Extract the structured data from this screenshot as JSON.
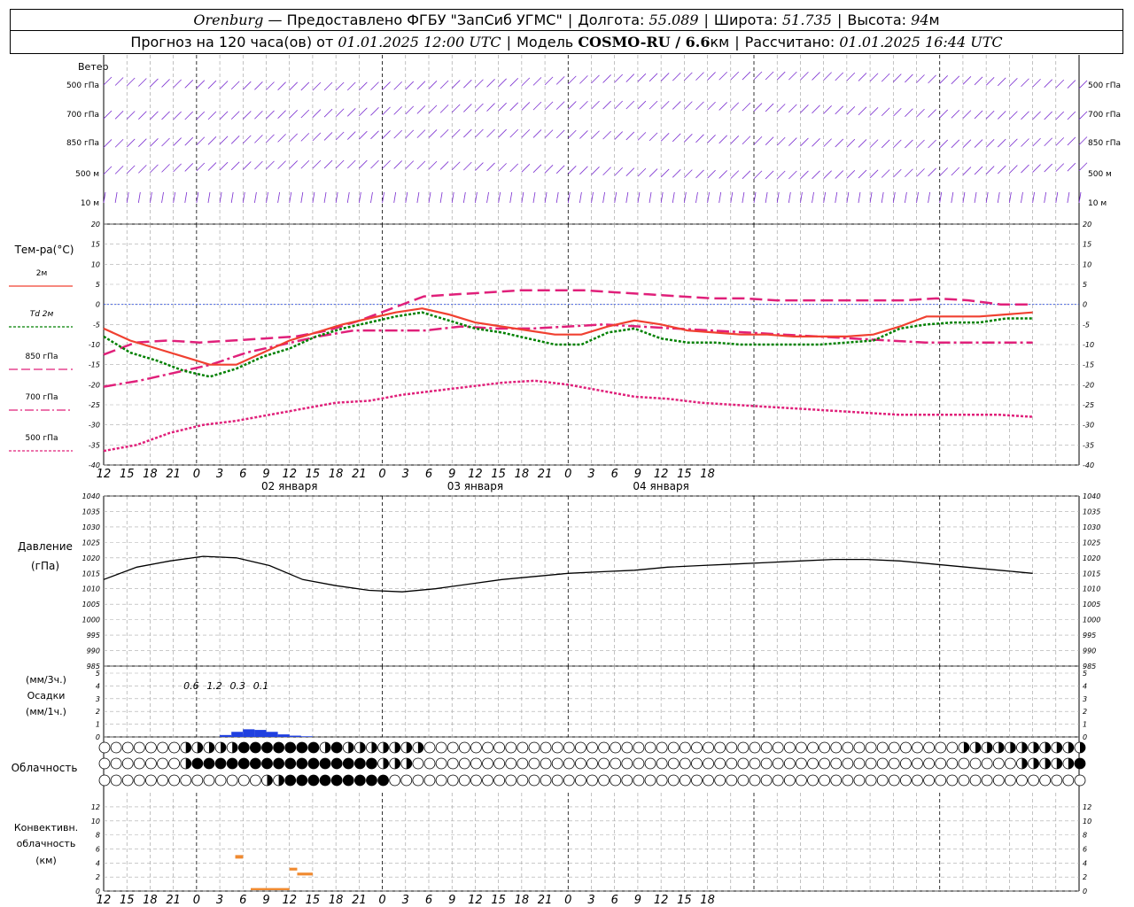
{
  "header": {
    "city": "Orenburg",
    "provider": "— Предоставлено ФГБУ \"ЗапСиб УГМС\"",
    "lon_label": "Долгота:",
    "lon": "55.089",
    "lat_label": "Широта:",
    "lat": "51.735",
    "alt_label": "Высота:",
    "alt": "94",
    "alt_unit": "м",
    "fc_label": "Прогноз на 120 часа(ов) от",
    "fc_time": "01.01.2025 12:00 UTC",
    "model_label": "Модель",
    "model": "COSMO-RU / 6.6",
    "model_unit": "км",
    "calc_label": "Рассчитано:",
    "calc_time": "01.01.2025 16:44 UTC"
  },
  "x_ticks": [
    "12",
    "15",
    "18",
    "21",
    "0",
    "3",
    "6",
    "9",
    "12",
    "15",
    "18",
    "21",
    "0",
    "3",
    "6",
    "9",
    "12",
    "15",
    "18",
    "21",
    "0",
    "3",
    "6",
    "9",
    "12",
    "15",
    "18"
  ],
  "dates": [
    "02 января",
    "03 января",
    "04 января"
  ],
  "wind_panel": {
    "title": "Ветер",
    "levels": [
      "500 гПа",
      "700 гПа",
      "850 гПа",
      "500 м",
      "10 м"
    ]
  },
  "temp_panel": {
    "title": "Тем-ра(°С)",
    "legend": [
      {
        "label": "2м",
        "color": "#f04030",
        "style": "solid"
      },
      {
        "label": "Td  2м",
        "color": "#008000",
        "style": "dotted"
      },
      {
        "label": "850 гПа",
        "color": "#e0207a",
        "style": "dash"
      },
      {
        "label": "700 гПа",
        "color": "#e0207a",
        "style": "dashdot"
      },
      {
        "label": "500 гПа",
        "color": "#e0207a",
        "style": "dotted"
      }
    ],
    "y_ticks": [
      "20",
      "15",
      "10",
      "5",
      "0",
      "-5",
      "-10",
      "-15",
      "-20",
      "-25",
      "-30",
      "-35",
      "-40"
    ]
  },
  "pressure_panel": {
    "title": "Давление",
    "unit": "(гПа)",
    "y_ticks": [
      "1040",
      "1035",
      "1030",
      "1025",
      "1020",
      "1015",
      "1010",
      "1005",
      "1000",
      "995",
      "990",
      "985"
    ]
  },
  "precip_panel": {
    "title": "Осадки",
    "unit_top": "(мм/3ч.)",
    "unit_bottom": "(мм/1ч.)",
    "y_ticks": [
      "5",
      "4",
      "3",
      "2",
      "1",
      "0"
    ],
    "totals": [
      {
        "hour": 6,
        "label": "0.6"
      },
      {
        "hour": 9,
        "label": "1.2"
      },
      {
        "hour": 12,
        "label": "0.3"
      },
      {
        "hour": 15,
        "label": "0.1"
      }
    ]
  },
  "cloud_panel": {
    "title": "Облачность"
  },
  "conv_panel": {
    "title_1": "Конвективн.",
    "title_2": "облачность",
    "unit": "(км)",
    "y_ticks": [
      "12",
      "10",
      "8",
      "6",
      "4",
      "2",
      "0"
    ]
  },
  "chart_data": {
    "type": "line",
    "x_hours": [
      0,
      6,
      9,
      12,
      15,
      18,
      21,
      24,
      27,
      30,
      33,
      36,
      39,
      42,
      45,
      48,
      51,
      54,
      57,
      60,
      63,
      66,
      69,
      72,
      75,
      78,
      81,
      84,
      87,
      90,
      93,
      96,
      99,
      102,
      105,
      108,
      111,
      114,
      117,
      120
    ],
    "series": [
      {
        "name": "2м",
        "values": [
          -6,
          -9,
          -11,
          -13,
          -15,
          -15,
          -12,
          -9,
          -7,
          -5,
          -3.5,
          -2,
          -1,
          -2.5,
          -4.5,
          -5.5,
          -6.5,
          -7.5,
          -7.5,
          -5.5,
          -4,
          -5,
          -6.5,
          -7,
          -7.5,
          -7.5,
          -8,
          -8,
          -8,
          -7.5,
          -5.5,
          -3,
          -3,
          -3,
          -2.5,
          -2
        ]
      },
      {
        "name": "Td  2м",
        "values": [
          -8,
          -12,
          -14,
          -16.5,
          -18,
          -16,
          -13,
          -11,
          -8,
          -6,
          -4.5,
          -3,
          -2,
          -4,
          -6,
          -7,
          -8.5,
          -10,
          -10,
          -7,
          -6,
          -8.5,
          -9.5,
          -9.5,
          -10,
          -10,
          -10,
          -10,
          -9.5,
          -9,
          -6,
          -5,
          -4.5,
          -4.5,
          -3.5,
          -3.5
        ]
      },
      {
        "name": "850 гПа",
        "values": [
          -12.5,
          -9.5,
          -9,
          -9.5,
          -9,
          -8.5,
          -8,
          -6.5,
          -4,
          -1,
          2,
          2.5,
          3,
          3.5,
          3.5,
          3.5,
          3,
          2.5,
          2,
          1.5,
          1.5,
          1,
          1,
          1,
          1,
          1,
          1.5,
          1,
          0,
          0
        ]
      },
      {
        "name": "700 гПа",
        "values": [
          -20.5,
          -19,
          -17,
          -15,
          -12,
          -10,
          -8,
          -6.5,
          -6.5,
          -6.5,
          -5.5,
          -6,
          -6,
          -5.5,
          -5,
          -5.5,
          -6,
          -6.5,
          -7,
          -7.5,
          -8,
          -8.5,
          -9,
          -9.5,
          -9.5,
          -9.5,
          -9.5
        ]
      },
      {
        "name": "500 гПа",
        "values": [
          -36.5,
          -35,
          -32,
          -30,
          -29,
          -27.5,
          -26,
          -24.5,
          -24,
          -22.5,
          -21.5,
          -20.5,
          -19.5,
          -19,
          -20,
          -21.5,
          -23,
          -23.5,
          -24.5,
          -25,
          -25.5,
          -26,
          -26.5,
          -27,
          -27.5,
          -27.5,
          -27.5,
          -27.5,
          -28
        ]
      },
      {
        "name": "Давление",
        "values": [
          1013,
          1017,
          1019,
          1020.5,
          1020,
          1017.5,
          1013,
          1011,
          1009.5,
          1009,
          1010,
          1011.5,
          1013,
          1014,
          1015,
          1015.5,
          1016,
          1017,
          1017.5,
          1018,
          1018.5,
          1019,
          1019.5,
          1019.5,
          1019,
          1018,
          1017,
          1016,
          1015
        ]
      },
      {
        "name": "Осадки",
        "values": [
          0.15,
          0.4,
          0.6,
          0.55,
          0.4,
          0.2,
          0.1,
          0.05
        ]
      }
    ],
    "temp_ylim": [
      -40,
      20
    ],
    "pressure_ylim": [
      985,
      1040
    ],
    "precip_ylim": [
      0,
      5
    ],
    "conv_ylim": [
      0,
      13
    ],
    "convective_cloud_km": [
      {
        "h0": 5,
        "h1": 6,
        "base": 4.5,
        "top": 5
      },
      {
        "h0": 12,
        "h1": 13,
        "base": 2.8,
        "top": 3.2
      },
      {
        "h0": 13,
        "h1": 15,
        "base": 2.1,
        "top": 2.5
      },
      {
        "h0": 7,
        "h1": 12,
        "base": 0,
        "top": 0.3
      }
    ],
    "cloud_rows": [
      "0000000132334444444343221313000000000000000000000000000000000000000000000033333333333333333",
      "0000000244444444444444443330000000000000000000000000000000000000000000000000000222234444",
      "00000000000000234444444440000000000000000000000000000000000000000000000000000000000000000"
    ]
  }
}
